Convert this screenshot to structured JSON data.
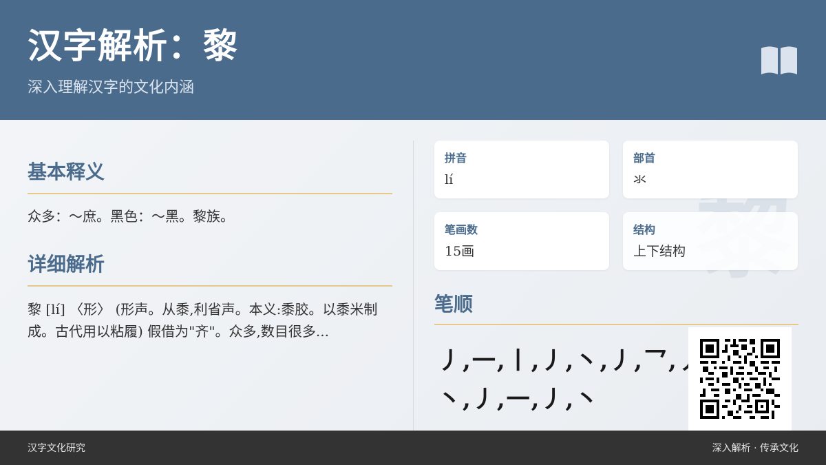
{
  "header": {
    "title": "汉字解析：黎",
    "subtitle": "深入理解汉字的文化内涵",
    "icon": "open-book-icon"
  },
  "basic_meaning": {
    "heading": "基本释义",
    "text": "众多：～庶。黑色：～黑。黎族。"
  },
  "detailed": {
    "heading": "详细解析",
    "text": "黎 [lí] 〈形〉 (形声。从黍,利省声。本义:黍胶。以黍米制成。古代用以粘履) 假借为\"齐\"。众多,数目很多..."
  },
  "info_cards": {
    "pinyin": {
      "label": "拼音",
      "value": "lí"
    },
    "radical": {
      "label": "部首",
      "value": "氺"
    },
    "strokes": {
      "label": "笔画数",
      "value": "15画"
    },
    "structure": {
      "label": "结构",
      "value": "上下结构"
    }
  },
  "watermark": "黎",
  "stroke_order": {
    "heading": "笔顺",
    "sequence": "丿,一,丨,丿,丶,丿,乛,丿,丿,丿,丶,丿,一,丿,丶"
  },
  "footer": {
    "left": "汉字文化研究",
    "right": "深入解析 · 传承文化"
  },
  "colors": {
    "header_bg": "#4a6b8c",
    "accent_line": "#e6c88c",
    "footer_bg": "#333333"
  }
}
